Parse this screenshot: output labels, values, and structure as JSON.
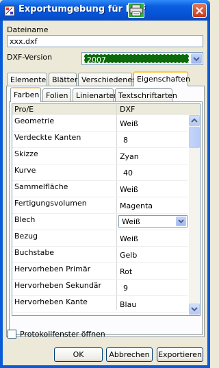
{
  "window": {
    "title": "Exportumgebung für DXF"
  },
  "dateiname": {
    "label": "Dateiname",
    "value": "xxx.dxf"
  },
  "dxf_version": {
    "label": "DXF-Version",
    "value": "2007"
  },
  "tabs": [
    "Elemente",
    "Blätter",
    "Verschiedenes",
    "Eigenschaften"
  ],
  "active_tab": "Eigenschaften",
  "subtabs": [
    "Farben",
    "Folien",
    "Linienarten",
    "Textschriftarten"
  ],
  "active_subtab": "Farben",
  "grid": {
    "columns": [
      "Pro/E",
      "DXF"
    ],
    "rows": [
      {
        "name": "Geometrie",
        "value": "Weiß"
      },
      {
        "name": "Verdeckte Kanten",
        "value": "8"
      },
      {
        "name": "Skizze",
        "value": "Zyan"
      },
      {
        "name": "Kurve",
        "value": "40"
      },
      {
        "name": "Sammelfläche",
        "value": "Weiß"
      },
      {
        "name": "Fertigungsvolumen",
        "value": "Magenta"
      },
      {
        "name": "Blech",
        "value": "Weiß"
      },
      {
        "name": "Bezug",
        "value": "Weiß"
      },
      {
        "name": "Buchstabe",
        "value": "Gelb"
      },
      {
        "name": "Hervorheben Primär",
        "value": "Rot"
      },
      {
        "name": "Hervorheben Sekundär",
        "value": "9"
      },
      {
        "name": "Hervorheben Kante",
        "value": "Blau"
      }
    ]
  },
  "checkbox": {
    "label": "Protokollfenster öffnen",
    "checked": false
  },
  "buttons": {
    "ok": "OK",
    "cancel": "Abbrechen",
    "export": "Exportieren"
  },
  "icons": {
    "app": "dxf-export-icon",
    "print": "printer-icon",
    "close": "close-icon"
  },
  "colors": {
    "title_bar": "#0653d6",
    "version_highlight": "#0b6b0b",
    "active_tab": "#ffc83c"
  }
}
